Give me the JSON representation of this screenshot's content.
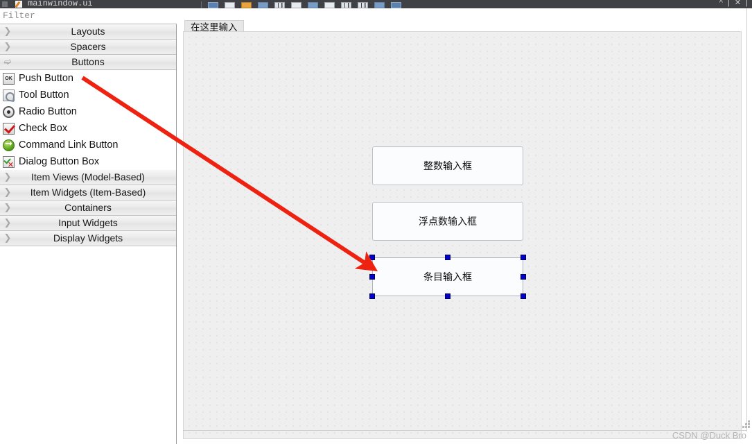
{
  "titlebar": {
    "document_title": "mainwindow.ui",
    "window_controls": "^ | ✕ |",
    "toolbar_icons": [
      "form-preview-icon",
      "edit-widgets-icon",
      "edit-signals-icon",
      "edit-buddies-icon",
      "edit-tab-order-icon",
      "layout-horizontal-icon",
      "layout-vertical-icon",
      "layout-splitter-h-icon",
      "layout-splitter-v-icon",
      "layout-grid-icon",
      "layout-form-icon",
      "break-layout-icon",
      "adjust-size-icon"
    ]
  },
  "widget_box": {
    "filter_placeholder": "Filter",
    "categories": [
      {
        "label": "Layouts",
        "expanded": false,
        "chevron": "chevron-right-icon"
      },
      {
        "label": "Spacers",
        "expanded": false,
        "chevron": "chevron-right-icon"
      },
      {
        "label": "Buttons",
        "expanded": true,
        "chevron": "chevron-down-icon"
      }
    ],
    "button_items": [
      {
        "label": "Push Button",
        "icon": "push-button-icon",
        "icon_text": "OK"
      },
      {
        "label": "Tool Button",
        "icon": "tool-button-icon",
        "icon_text": ""
      },
      {
        "label": "Radio Button",
        "icon": "radio-button-icon",
        "icon_text": ""
      },
      {
        "label": "Check Box",
        "icon": "check-box-icon",
        "icon_text": ""
      },
      {
        "label": "Command Link Button",
        "icon": "command-link-button-icon",
        "icon_text": ""
      },
      {
        "label": "Dialog Button Box",
        "icon": "dialog-button-box-icon",
        "icon_text": ""
      }
    ],
    "trailing_categories": [
      {
        "label": "Item Views (Model-Based)",
        "expanded": false,
        "chevron": "chevron-right-icon"
      },
      {
        "label": "Item Widgets (Item-Based)",
        "expanded": false,
        "chevron": "chevron-right-icon"
      },
      {
        "label": "Containers",
        "expanded": false,
        "chevron": "chevron-right-icon"
      },
      {
        "label": "Input Widgets",
        "expanded": false,
        "chevron": "chevron-right-icon"
      },
      {
        "label": "Display Widgets",
        "expanded": false,
        "chevron": "chevron-right-icon"
      }
    ]
  },
  "form_editor": {
    "menubar_placeholder": "在这里输入",
    "widgets": [
      {
        "label": "整数输入框",
        "selected": false
      },
      {
        "label": "浮点数输入框",
        "selected": false
      },
      {
        "label": "条目输入框",
        "selected": true
      }
    ],
    "selection_handle_count": 8
  },
  "annotation": {
    "arrow_color": "#ee2211",
    "from": "push-button-item",
    "to": "selected-widget"
  },
  "watermark": {
    "text": "CSDN @Duck Bro"
  },
  "colors": {
    "titlebar_bg": "#3f4144",
    "canvas_bg": "#efefef",
    "selection_handle": "#0000c8",
    "accent_red": "#ee2211"
  }
}
